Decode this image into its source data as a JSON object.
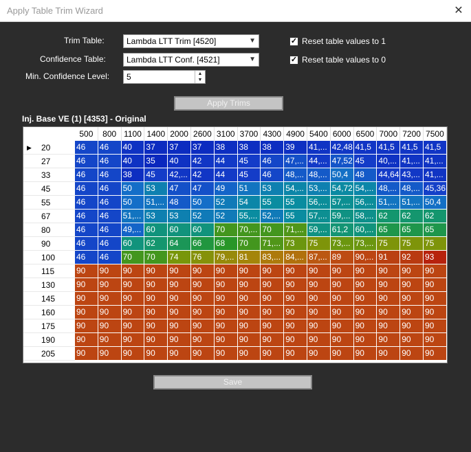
{
  "window": {
    "title": "Apply Table Trim Wizard"
  },
  "form": {
    "trim_table_label": "Trim Table:",
    "trim_table_value": "Lambda LTT Trim [4520]",
    "confidence_table_label": "Confidence Table:",
    "confidence_table_value": "Lambda LTT Conf. [4521]",
    "min_conf_label": "Min. Confidence Level:",
    "min_conf_value": "5",
    "reset1_label": "Reset table values to 1",
    "reset1_checked": true,
    "reset0_label": "Reset table values to 0",
    "reset0_checked": true,
    "apply_label": "Apply Trims",
    "save_label": "Save"
  },
  "table": {
    "title": "Inj. Base VE (1) [4353] - Original",
    "columns": [
      "500",
      "800",
      "1100",
      "1400",
      "2000",
      "2600",
      "3100",
      "3700",
      "4300",
      "4900",
      "5400",
      "6000",
      "6500",
      "7000",
      "7200",
      "7500"
    ],
    "rows": [
      "20",
      "27",
      "33",
      "45",
      "55",
      "67",
      "80",
      "90",
      "100",
      "115",
      "130",
      "145",
      "160",
      "175",
      "190",
      "205"
    ],
    "cells": [
      [
        "46",
        "46",
        "40",
        "37",
        "37",
        "37",
        "38",
        "38",
        "38",
        "39",
        "41,...",
        "42,48",
        "41,5",
        "41,5",
        "41,5",
        "41,5"
      ],
      [
        "46",
        "46",
        "40",
        "35",
        "40",
        "42",
        "44",
        "45",
        "46",
        "47,...",
        "44,...",
        "47,52",
        "45",
        "40,...",
        "41,...",
        "41,..."
      ],
      [
        "46",
        "46",
        "38",
        "45",
        "42,...",
        "42",
        "44",
        "45",
        "46",
        "48,...",
        "48,...",
        "50,4",
        "48",
        "44,64",
        "43,...",
        "41,..."
      ],
      [
        "46",
        "46",
        "50",
        "53",
        "47",
        "47",
        "49",
        "51",
        "53",
        "54,...",
        "53,...",
        "54,72",
        "54,...",
        "48,...",
        "48,...",
        "45,36"
      ],
      [
        "46",
        "46",
        "50",
        "51,...",
        "48",
        "50",
        "52",
        "54",
        "55",
        "55",
        "56,...",
        "57,...",
        "56,...",
        "51,...",
        "51,...",
        "50,4"
      ],
      [
        "46",
        "46",
        "51,...",
        "53",
        "53",
        "52",
        "52",
        "55,...",
        "52,...",
        "55",
        "57,...",
        "59,...",
        "58,...",
        "62",
        "62",
        "62"
      ],
      [
        "46",
        "46",
        "49,...",
        "60",
        "60",
        "60",
        "70",
        "70,...",
        "70",
        "71,...",
        "59,...",
        "61,2",
        "60,...",
        "65",
        "65",
        "65"
      ],
      [
        "46",
        "46",
        "60",
        "62",
        "64",
        "66",
        "68",
        "70",
        "71,...",
        "73",
        "75",
        "73,...",
        "73,...",
        "75",
        "75",
        "75"
      ],
      [
        "46",
        "46",
        "70",
        "70",
        "74",
        "76",
        "79,...",
        "81",
        "83,...",
        "84,...",
        "87,...",
        "89",
        "90,...",
        "91",
        "92",
        "93"
      ],
      [
        "90",
        "90",
        "90",
        "90",
        "90",
        "90",
        "90",
        "90",
        "90",
        "90",
        "90",
        "90",
        "90",
        "90",
        "90",
        "90"
      ],
      [
        "90",
        "90",
        "90",
        "90",
        "90",
        "90",
        "90",
        "90",
        "90",
        "90",
        "90",
        "90",
        "90",
        "90",
        "90",
        "90"
      ],
      [
        "90",
        "90",
        "90",
        "90",
        "90",
        "90",
        "90",
        "90",
        "90",
        "90",
        "90",
        "90",
        "90",
        "90",
        "90",
        "90"
      ],
      [
        "90",
        "90",
        "90",
        "90",
        "90",
        "90",
        "90",
        "90",
        "90",
        "90",
        "90",
        "90",
        "90",
        "90",
        "90",
        "90"
      ],
      [
        "90",
        "90",
        "90",
        "90",
        "90",
        "90",
        "90",
        "90",
        "90",
        "90",
        "90",
        "90",
        "90",
        "90",
        "90",
        "90"
      ],
      [
        "90",
        "90",
        "90",
        "90",
        "90",
        "90",
        "90",
        "90",
        "90",
        "90",
        "90",
        "90",
        "90",
        "90",
        "90",
        "90"
      ],
      [
        "90",
        "90",
        "90",
        "90",
        "90",
        "90",
        "90",
        "90",
        "90",
        "90",
        "90",
        "90",
        "90",
        "90",
        "90",
        "90"
      ]
    ],
    "selected_row": 0
  },
  "colors": {
    "heat_low": "#0b2fb8",
    "heat_high": "#b83a10",
    "background": "#2c2c2c"
  }
}
